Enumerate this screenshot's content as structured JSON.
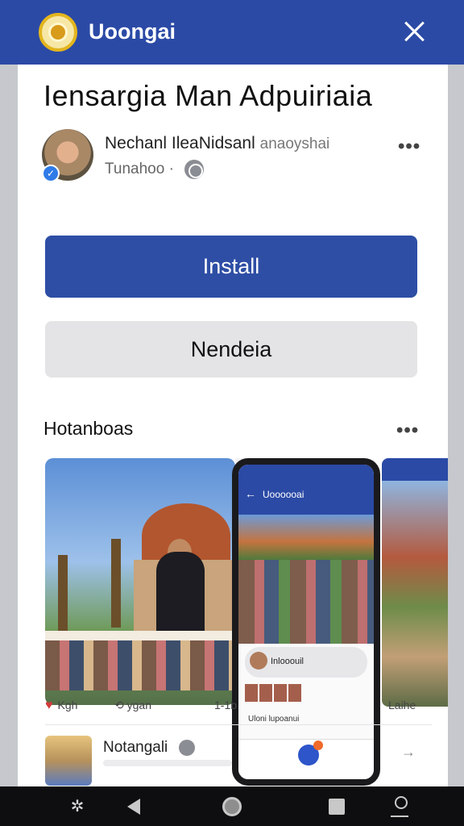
{
  "header": {
    "app_name": "Uoongai",
    "logo_icon": "emblem-icon",
    "close_icon": "close-icon",
    "bg_color": "#2b4aa6"
  },
  "app": {
    "title": "Iensargia Man Adpuiriaia",
    "publisher_name": "Nechanl IleaNidsanl",
    "publisher_sub": "anaoyshai",
    "publisher_line2": "Tunahoo ·",
    "more_icon": "more-horizontal-icon"
  },
  "buttons": {
    "install_label": "Install",
    "secondary_label": "Nendeia",
    "install_color": "#2e4ea5"
  },
  "section": {
    "title": "Hotanboas",
    "more_icon": "more-horizontal-icon"
  },
  "phone_mock": {
    "title": "Uoooooai",
    "bubble_text": "Inlooouil",
    "line_text": "Uloni lupoanui"
  },
  "post_actions": {
    "like_label": "Kgh",
    "share_label": "ygan",
    "right_a": "1-1b",
    "right_b": "Laihe"
  },
  "bottom_item": {
    "name": "Notangali"
  },
  "navbar": {
    "items": [
      "pinwheel-icon",
      "back-icon",
      "home-icon",
      "recents-icon",
      "profile-icon"
    ]
  }
}
